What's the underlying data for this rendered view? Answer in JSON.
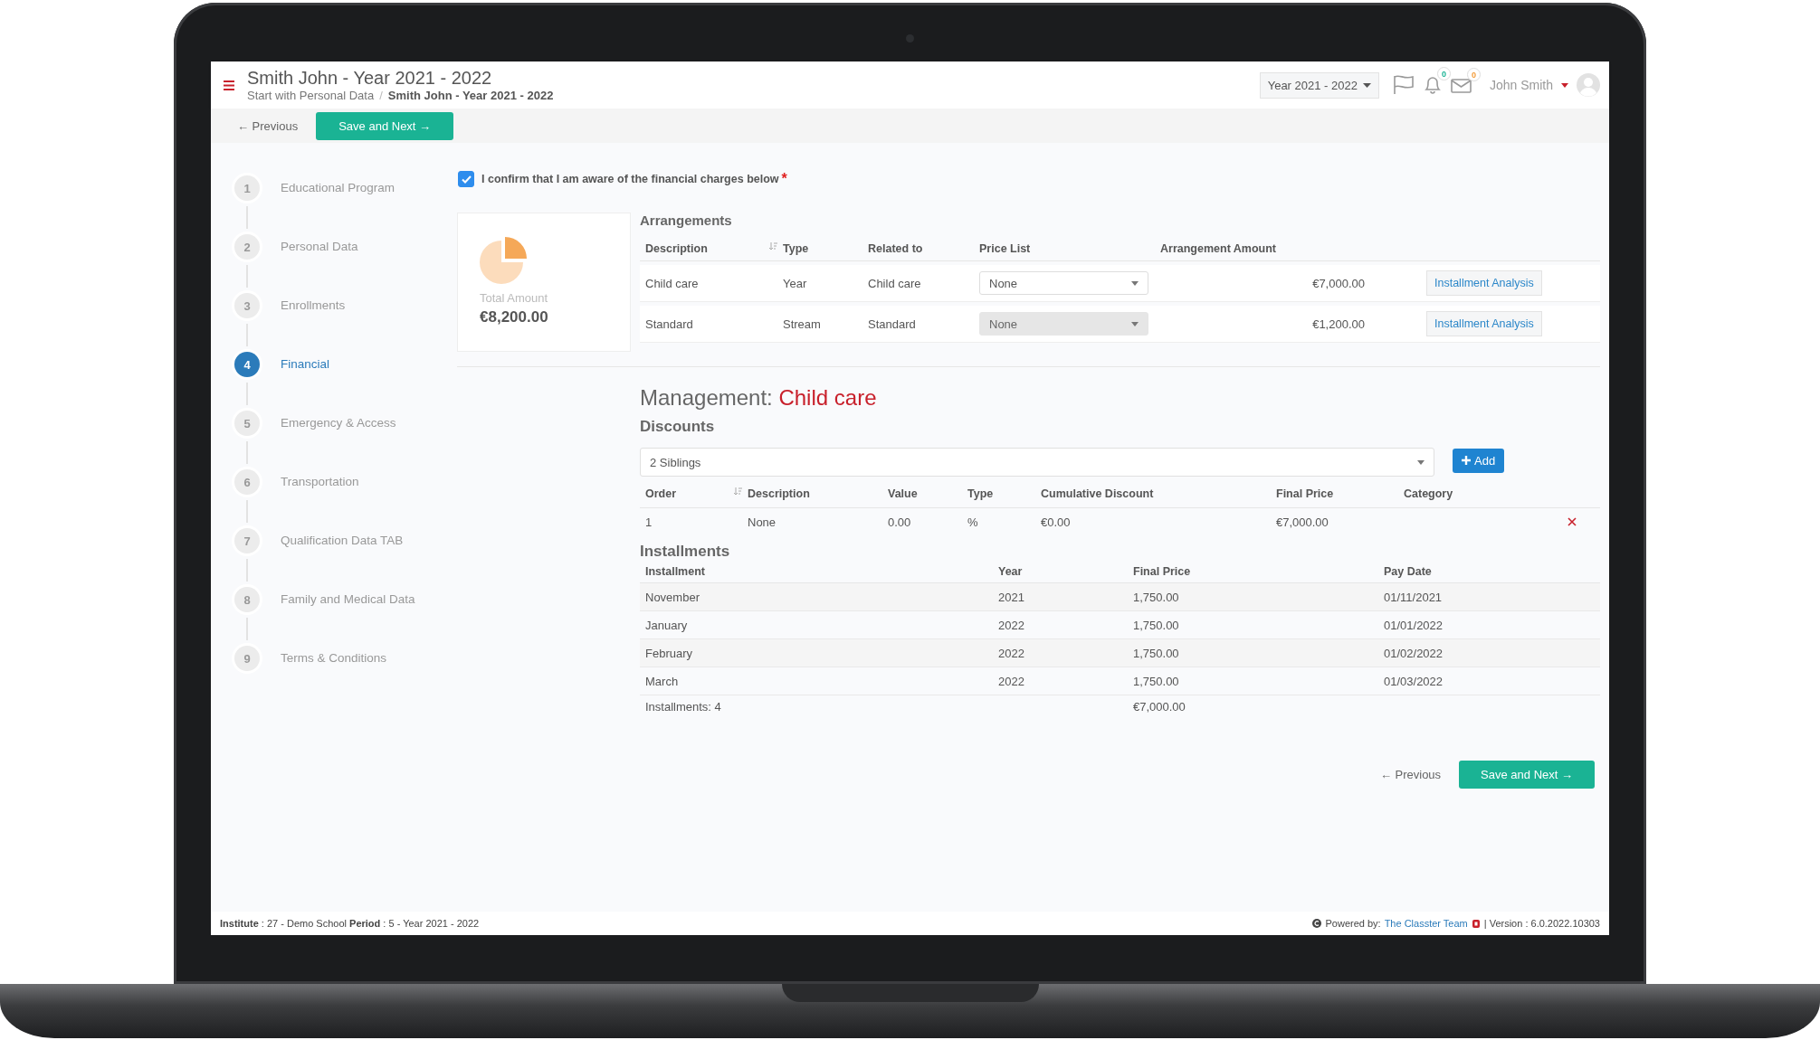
{
  "header": {
    "title": "Smith John - Year 2021 - 2022",
    "breadcrumb": [
      "Start with Personal Data",
      "/",
      "Smith John - Year 2021 - 2022"
    ],
    "year_select": "Year 2021 - 2022",
    "notifications": "0",
    "messages": "0",
    "user": "John Smith"
  },
  "toolbar": {
    "previous": "← Previous",
    "next": "Save and Next →"
  },
  "steps": [
    {
      "number": "1",
      "label": "Educational Program",
      "selected": false
    },
    {
      "number": "2",
      "label": "Personal Data",
      "selected": false
    },
    {
      "number": "3",
      "label": "Enrollments",
      "selected": false
    },
    {
      "number": "4",
      "label": "Financial",
      "selected": true
    },
    {
      "number": "5",
      "label": "Emergency & Access",
      "selected": false
    },
    {
      "number": "6",
      "label": "Transportation",
      "selected": false
    },
    {
      "number": "7",
      "label": "Qualification Data TAB",
      "selected": false
    },
    {
      "number": "8",
      "label": "Family and Medical Data",
      "selected": false
    },
    {
      "number": "9",
      "label": "Terms & Conditions",
      "selected": false
    }
  ],
  "confirm": {
    "label": "I confirm that I am aware of the financial charges below",
    "required": "*",
    "checked": true
  },
  "total": {
    "label": "Total Amount",
    "value": "€8,200.00"
  },
  "arrangements": {
    "title": "Arrangements",
    "columns": [
      "Description",
      "Type",
      "Related to",
      "Price List",
      "Arrangement Amount"
    ],
    "rows": [
      {
        "description": "Child care",
        "type": "Year",
        "related_to": "Child care",
        "price_list": "None",
        "disabled": false,
        "amount": "€7,000.00",
        "action": "Installment Analysis"
      },
      {
        "description": "Standard",
        "type": "Stream",
        "related_to": "Standard",
        "price_list": "None",
        "disabled": true,
        "amount": "€1,200.00",
        "action": "Installment Analysis"
      }
    ]
  },
  "management": {
    "label": "Management:",
    "subject": "Child care"
  },
  "discounts": {
    "title": "Discounts",
    "select": "2 Siblings",
    "add": "Add",
    "columns": [
      "Order",
      "Description",
      "Value",
      "Type",
      "Cumulative Discount",
      "Final Price",
      "Category"
    ],
    "rows": [
      {
        "order": "1",
        "description": "None",
        "value": "0.00",
        "type": "%",
        "cumulative": "€0.00",
        "final_price": "€7,000.00"
      }
    ]
  },
  "installments": {
    "title": "Installments",
    "columns": [
      "Installment",
      "Year",
      "Final Price",
      "Pay Date"
    ],
    "rows": [
      {
        "installment": "November",
        "year": "2021",
        "final_price": "1,750.00",
        "pay_date": "01/11/2021"
      },
      {
        "installment": "January",
        "year": "2022",
        "final_price": "1,750.00",
        "pay_date": "01/01/2022"
      },
      {
        "installment": "February",
        "year": "2022",
        "final_price": "1,750.00",
        "pay_date": "01/02/2022"
      },
      {
        "installment": "March",
        "year": "2022",
        "final_price": "1,750.00",
        "pay_date": "01/03/2022"
      }
    ],
    "summary": {
      "count": "Installments: 4",
      "total": "€7,000.00"
    }
  },
  "bottom_nav": {
    "previous": "← Previous",
    "next": "Save and Next →"
  },
  "footer": {
    "info": "**Institute** : 27 - Demo School **Period** : 5 - Year 2021 - 2022",
    "powered": "Powered by:",
    "link": "The Classter Team",
    "version": "| Version : 6.0.2022.10303"
  }
}
